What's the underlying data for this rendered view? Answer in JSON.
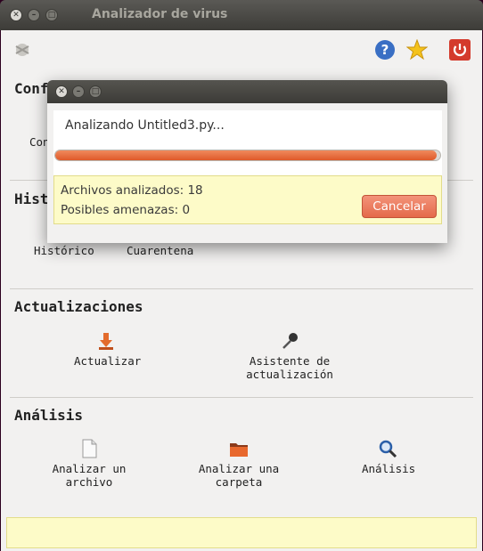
{
  "window": {
    "title": "Analizador de virus"
  },
  "sections": {
    "config_partial": "Conf",
    "config_item_partial": "Con",
    "history_partial": "Hist",
    "history_items": [
      "Histórico",
      "Cuarentena"
    ],
    "updates_title": "Actualizaciones",
    "updates_items": [
      "Actualizar",
      "Asistente de actualización"
    ],
    "analysis_title": "Análisis",
    "analysis_items": [
      "Analizar un archivo",
      "Analizar una carpeta",
      "Análisis"
    ]
  },
  "toolbar": {
    "icons": [
      "help-icon",
      "favorite-star-icon",
      "power-icon"
    ]
  },
  "dialog": {
    "message": "Analizando Untitled3.py...",
    "progress": 0.99,
    "files_scanned": "Archivos analizados: 18",
    "threats": "Posibles amenazas: 0",
    "cancel_label": "Cancelar"
  },
  "colors": {
    "accent": "#df5a2a",
    "info_bg": "#fdfbc8",
    "titlebar": "#3c3b37"
  }
}
